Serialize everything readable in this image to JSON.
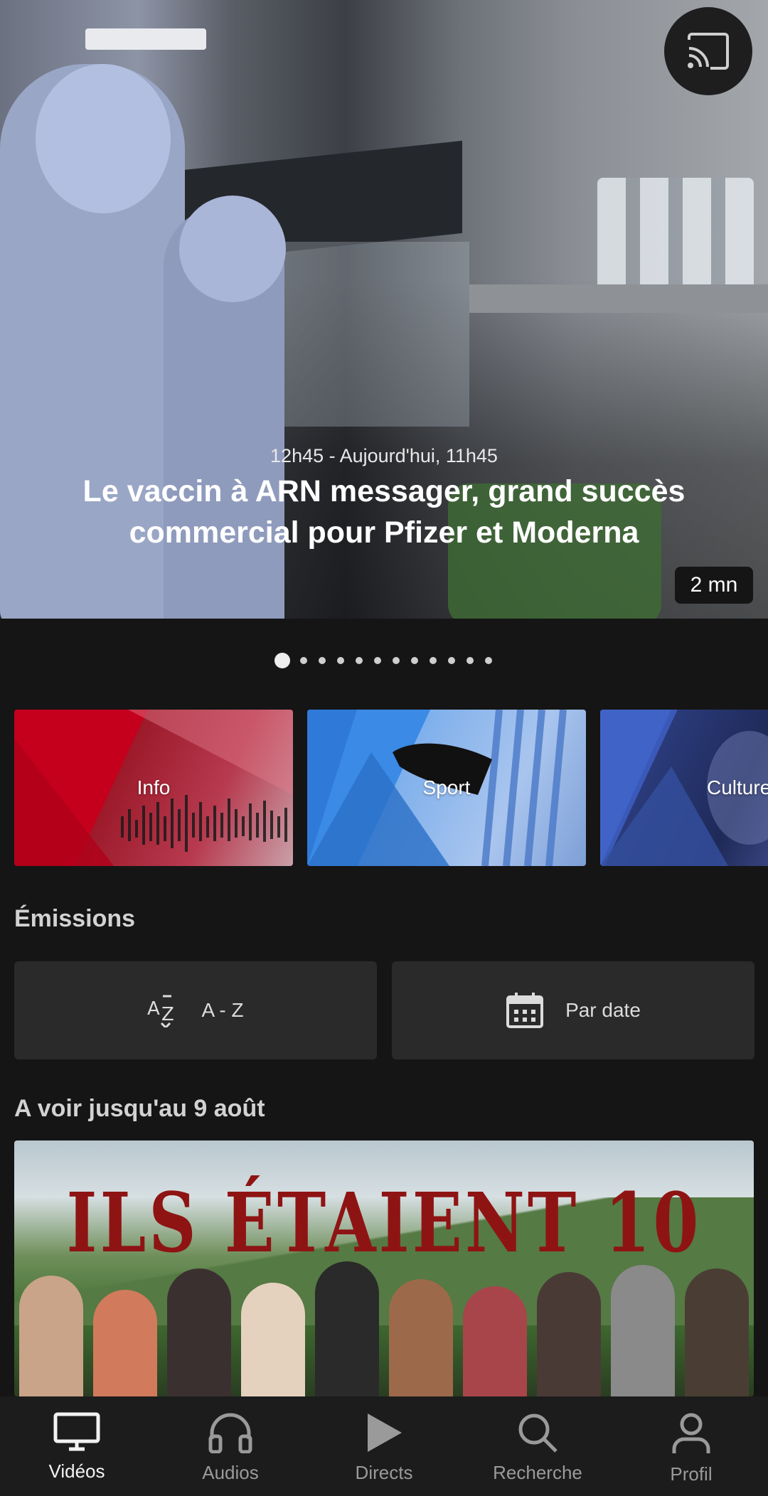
{
  "hero": {
    "meta": "12h45 - Aujourd'hui, 11h45",
    "title": "Le vaccin à ARN messager, grand succès commercial pour Pfizer et Moderna",
    "duration": "2 mn",
    "cast_icon": "cast-icon"
  },
  "carousel": {
    "count": 12,
    "active_index": 0
  },
  "categories": [
    {
      "label": "Info",
      "color": "#c4001d"
    },
    {
      "label": "Sport",
      "color": "#3a8ae6"
    },
    {
      "label": "Culture",
      "color": "#3a59b8"
    }
  ],
  "emissions": {
    "title": "Émissions",
    "az_label": "A - Z",
    "az_icon": "az-sort-icon",
    "date_label": "Par date",
    "date_icon": "calendar-icon"
  },
  "featured": {
    "title": "A voir jusqu'au 9 août",
    "poster_title": "ILS ÉTAIENT 10"
  },
  "nav": [
    {
      "label": "Vidéos",
      "icon": "monitor-icon",
      "active": true
    },
    {
      "label": "Audios",
      "icon": "headphones-icon",
      "active": false
    },
    {
      "label": "Directs",
      "icon": "play-icon",
      "active": false
    },
    {
      "label": "Recherche",
      "icon": "search-icon",
      "active": false
    },
    {
      "label": "Profil",
      "icon": "profile-icon",
      "active": false
    }
  ]
}
